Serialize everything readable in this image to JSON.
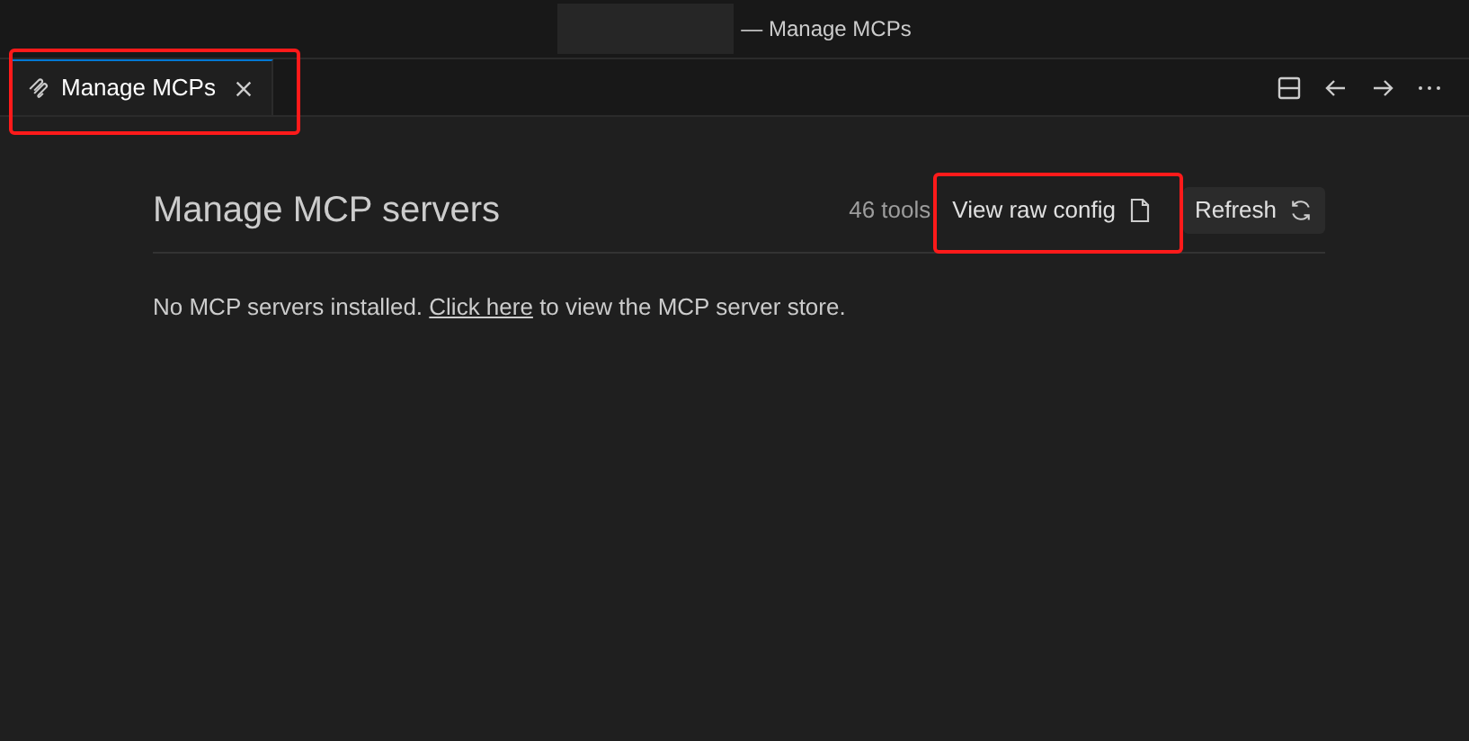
{
  "window": {
    "title": "— Manage MCPs"
  },
  "tabs": [
    {
      "label": "Manage MCPs",
      "selected": true
    }
  ],
  "page": {
    "heading": "Manage MCP servers",
    "tool_count": "46 tools",
    "buttons": [
      {
        "label": "View raw config",
        "kind": "file"
      },
      {
        "label": "Refresh",
        "kind": "refresh"
      }
    ],
    "message": {
      "before": "No MCP servers installed.",
      "link": "Click here",
      "after": "to view the MCP server store."
    }
  }
}
